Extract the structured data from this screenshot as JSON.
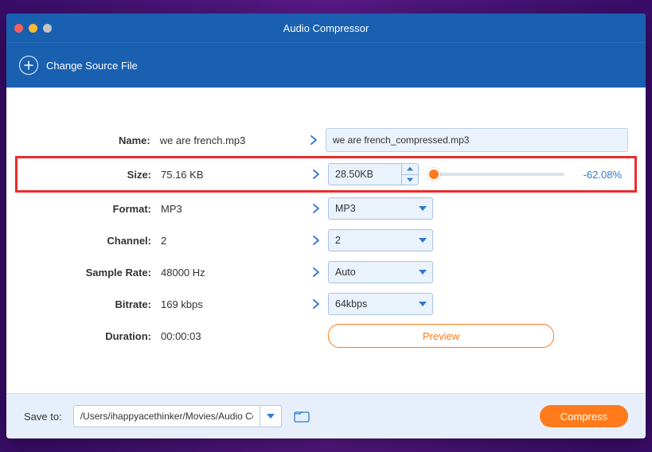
{
  "window": {
    "title": "Audio Compressor"
  },
  "toolbar": {
    "change_source_label": "Change Source File"
  },
  "labels": {
    "name": "Name:",
    "size": "Size:",
    "format": "Format:",
    "channel": "Channel:",
    "sample_rate": "Sample Rate:",
    "bitrate": "Bitrate:",
    "duration": "Duration:"
  },
  "source": {
    "name": "we are french.mp3",
    "size": "75.16 KB",
    "format": "MP3",
    "channel": "2",
    "sample_rate": "48000 Hz",
    "bitrate": "169 kbps",
    "duration": "00:00:03"
  },
  "target": {
    "name": "we are french_compressed.mp3",
    "size": "28.50KB",
    "size_delta": "-62.08%",
    "format": "MP3",
    "channel": "2",
    "sample_rate": "Auto",
    "bitrate": "64kbps"
  },
  "actions": {
    "preview": "Preview",
    "compress": "Compress"
  },
  "save": {
    "label": "Save to:",
    "path": "/Users/ihappyacethinker/Movies/Audio Compressed"
  }
}
